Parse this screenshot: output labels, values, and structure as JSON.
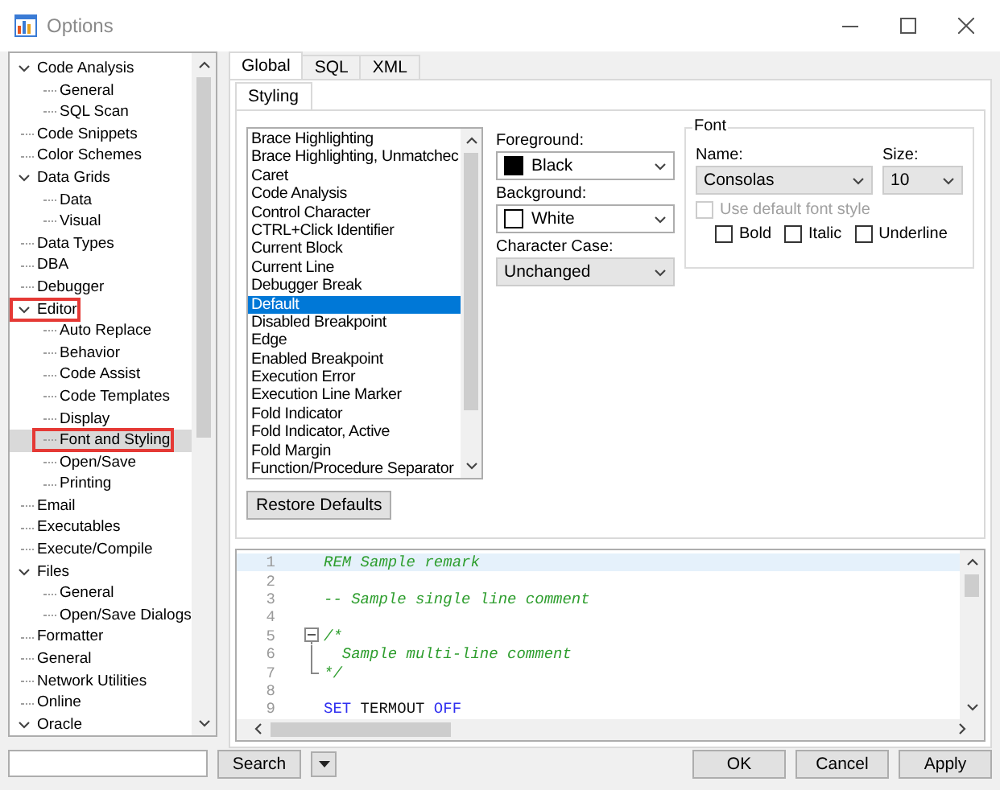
{
  "window": {
    "title": "Options"
  },
  "tree": {
    "items": [
      {
        "label": "Code Analysis",
        "selected": false,
        "highlighted": false,
        "expanded": true,
        "children": [
          {
            "label": "General",
            "selected": false,
            "highlighted": false
          },
          {
            "label": "SQL Scan",
            "selected": false,
            "highlighted": false
          }
        ]
      },
      {
        "label": "Code Snippets",
        "selected": false,
        "highlighted": false
      },
      {
        "label": "Color Schemes",
        "selected": false,
        "highlighted": false
      },
      {
        "label": "Data Grids",
        "selected": false,
        "highlighted": false,
        "expanded": true,
        "children": [
          {
            "label": "Data",
            "selected": false,
            "highlighted": false
          },
          {
            "label": "Visual",
            "selected": false,
            "highlighted": false
          }
        ]
      },
      {
        "label": "Data Types",
        "selected": false,
        "highlighted": false
      },
      {
        "label": "DBA",
        "selected": false,
        "highlighted": false
      },
      {
        "label": "Debugger",
        "selected": false,
        "highlighted": false
      },
      {
        "label": "Editor",
        "selected": false,
        "highlighted": true,
        "expanded": true,
        "children": [
          {
            "label": "Auto Replace",
            "selected": false,
            "highlighted": false
          },
          {
            "label": "Behavior",
            "selected": false,
            "highlighted": false
          },
          {
            "label": "Code Assist",
            "selected": false,
            "highlighted": false
          },
          {
            "label": "Code Templates",
            "selected": false,
            "highlighted": false
          },
          {
            "label": "Display",
            "selected": false,
            "highlighted": false
          },
          {
            "label": "Font and Styling",
            "selected": true,
            "highlighted": true
          },
          {
            "label": "Open/Save",
            "selected": false,
            "highlighted": false
          },
          {
            "label": "Printing",
            "selected": false,
            "highlighted": false
          }
        ]
      },
      {
        "label": "Email",
        "selected": false,
        "highlighted": false
      },
      {
        "label": "Executables",
        "selected": false,
        "highlighted": false
      },
      {
        "label": "Execute/Compile",
        "selected": false,
        "highlighted": false
      },
      {
        "label": "Files",
        "selected": false,
        "highlighted": false,
        "expanded": true,
        "children": [
          {
            "label": "General",
            "selected": false,
            "highlighted": false
          },
          {
            "label": "Open/Save Dialogs",
            "selected": false,
            "highlighted": false
          }
        ]
      },
      {
        "label": "Formatter",
        "selected": false,
        "highlighted": false
      },
      {
        "label": "General",
        "selected": false,
        "highlighted": false
      },
      {
        "label": "Network Utilities",
        "selected": false,
        "highlighted": false
      },
      {
        "label": "Online",
        "selected": false,
        "highlighted": false
      },
      {
        "label": "Oracle",
        "selected": false,
        "highlighted": false,
        "expanded": true
      }
    ]
  },
  "tabs": [
    {
      "label": "Global",
      "selected": true
    },
    {
      "label": "SQL",
      "selected": false
    },
    {
      "label": "XML",
      "selected": false
    }
  ],
  "subtabs": [
    {
      "label": "Styling",
      "selected": true
    }
  ],
  "style_list": {
    "items": [
      {
        "label": "Brace Highlighting",
        "selected": false
      },
      {
        "label": "Brace Highlighting, Unmatchec",
        "selected": false
      },
      {
        "label": "Caret",
        "selected": false
      },
      {
        "label": "Code Analysis",
        "selected": false
      },
      {
        "label": "Control Character",
        "selected": false
      },
      {
        "label": "CTRL+Click Identifier",
        "selected": false
      },
      {
        "label": "Current Block",
        "selected": false
      },
      {
        "label": "Current Line",
        "selected": false
      },
      {
        "label": "Debugger Break",
        "selected": false
      },
      {
        "label": "Default",
        "selected": true
      },
      {
        "label": "Disabled Breakpoint",
        "selected": false
      },
      {
        "label": "Edge",
        "selected": false
      },
      {
        "label": "Enabled Breakpoint",
        "selected": false
      },
      {
        "label": "Execution Error",
        "selected": false
      },
      {
        "label": "Execution Line Marker",
        "selected": false
      },
      {
        "label": "Fold Indicator",
        "selected": false
      },
      {
        "label": "Fold Indicator, Active",
        "selected": false
      },
      {
        "label": "Fold Margin",
        "selected": false
      },
      {
        "label": "Function/Procedure Separator",
        "selected": false
      }
    ]
  },
  "colors": [
    {
      "label": "Foreground:",
      "value": "Black",
      "color": "#000000"
    },
    {
      "label": "Background:",
      "value": "White",
      "color": "#ffffff"
    }
  ],
  "character_case": {
    "label": "Character Case:",
    "value": "Unchanged"
  },
  "font": {
    "title": "Font",
    "name_label": "Name:",
    "name": "Consolas",
    "size_label": "Size:",
    "size": "10",
    "use_default": {
      "label": "Use default font style",
      "checked": false,
      "disabled": true
    },
    "styles": [
      {
        "label": "Bold",
        "checked": false
      },
      {
        "label": "Italic",
        "checked": false
      },
      {
        "label": "Underline",
        "checked": false
      }
    ]
  },
  "restore_button": "Restore Defaults",
  "preview": {
    "lines": [
      {
        "number": "1",
        "kind": "plain",
        "current": true,
        "tokens": [
          {
            "kind": "comment",
            "text": "REM Sample remark"
          }
        ]
      },
      {
        "number": "2",
        "kind": "plain",
        "current": false
      },
      {
        "number": "3",
        "kind": "plain",
        "current": false,
        "tokens": [
          {
            "kind": "comment",
            "text": "-- Sample single line comment"
          }
        ]
      },
      {
        "number": "4",
        "kind": "plain",
        "current": false
      },
      {
        "number": "5",
        "kind": "foldstart",
        "current": false,
        "tokens": [
          {
            "kind": "comment",
            "text": "/*"
          }
        ]
      },
      {
        "number": "6",
        "kind": "foldbody",
        "current": false,
        "tokens": [
          {
            "kind": "comment",
            "text": "  Sample multi-line comment"
          }
        ]
      },
      {
        "number": "7",
        "kind": "foldend",
        "current": false,
        "tokens": [
          {
            "kind": "comment",
            "text": "*/"
          }
        ]
      },
      {
        "number": "8",
        "kind": "plain",
        "current": false
      },
      {
        "number": "9",
        "kind": "plain",
        "current": false,
        "tokens": [
          {
            "kind": "keyword",
            "text": "SET"
          },
          {
            "kind": "plain",
            "text": " TERMOUT "
          },
          {
            "kind": "keyword",
            "text": "OFF"
          }
        ]
      }
    ]
  },
  "footer": {
    "search_button": "Search",
    "buttons": [
      "OK",
      "Cancel",
      "Apply"
    ]
  }
}
